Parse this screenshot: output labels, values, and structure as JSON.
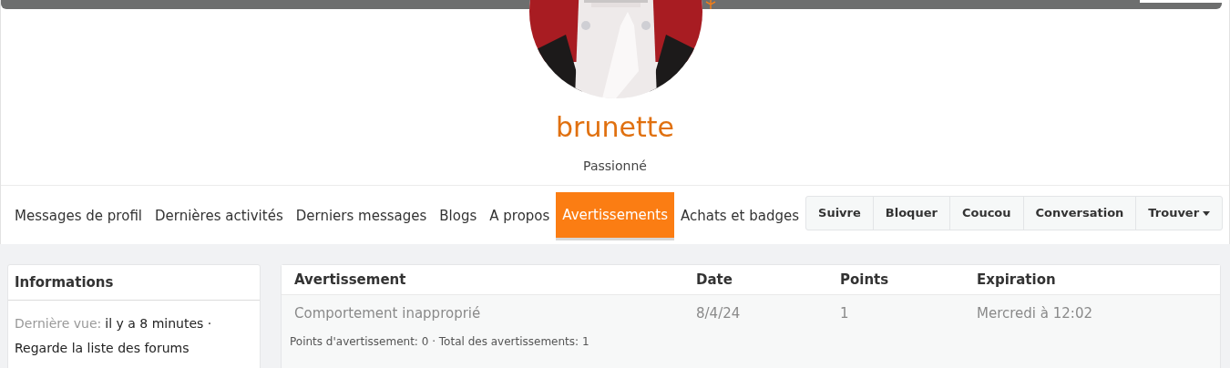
{
  "profile": {
    "username": "brunette",
    "rank": "Passionné"
  },
  "tabs": [
    {
      "label": "Messages de profil",
      "selected": false
    },
    {
      "label": "Dernières activités",
      "selected": false
    },
    {
      "label": "Derniers messages",
      "selected": false
    },
    {
      "label": "Blogs",
      "selected": false
    },
    {
      "label": "A propos",
      "selected": false
    },
    {
      "label": "Avertissements",
      "selected": true
    },
    {
      "label": "Achats et badges",
      "selected": false
    }
  ],
  "actions": [
    {
      "label": "Suivre",
      "dropdown": false
    },
    {
      "label": "Bloquer",
      "dropdown": false
    },
    {
      "label": "Coucou",
      "dropdown": false
    },
    {
      "label": "Conversation",
      "dropdown": false
    },
    {
      "label": "Trouver",
      "dropdown": true
    }
  ],
  "info_panel": {
    "title": "Informations",
    "last_seen_label": "Dernière vue:",
    "last_seen_value": "il y a 8 minutes ·",
    "activity": "Regarde la liste des forums"
  },
  "warnings": {
    "columns": [
      "Avertissement",
      "Date",
      "Points",
      "Expiration"
    ],
    "rows": [
      [
        "Comportement inapproprié",
        "8/4/24",
        "1",
        "Mercredi à 12:02"
      ]
    ],
    "summary": "Points d'avertissement: 0 · Total des avertissements: 1"
  }
}
